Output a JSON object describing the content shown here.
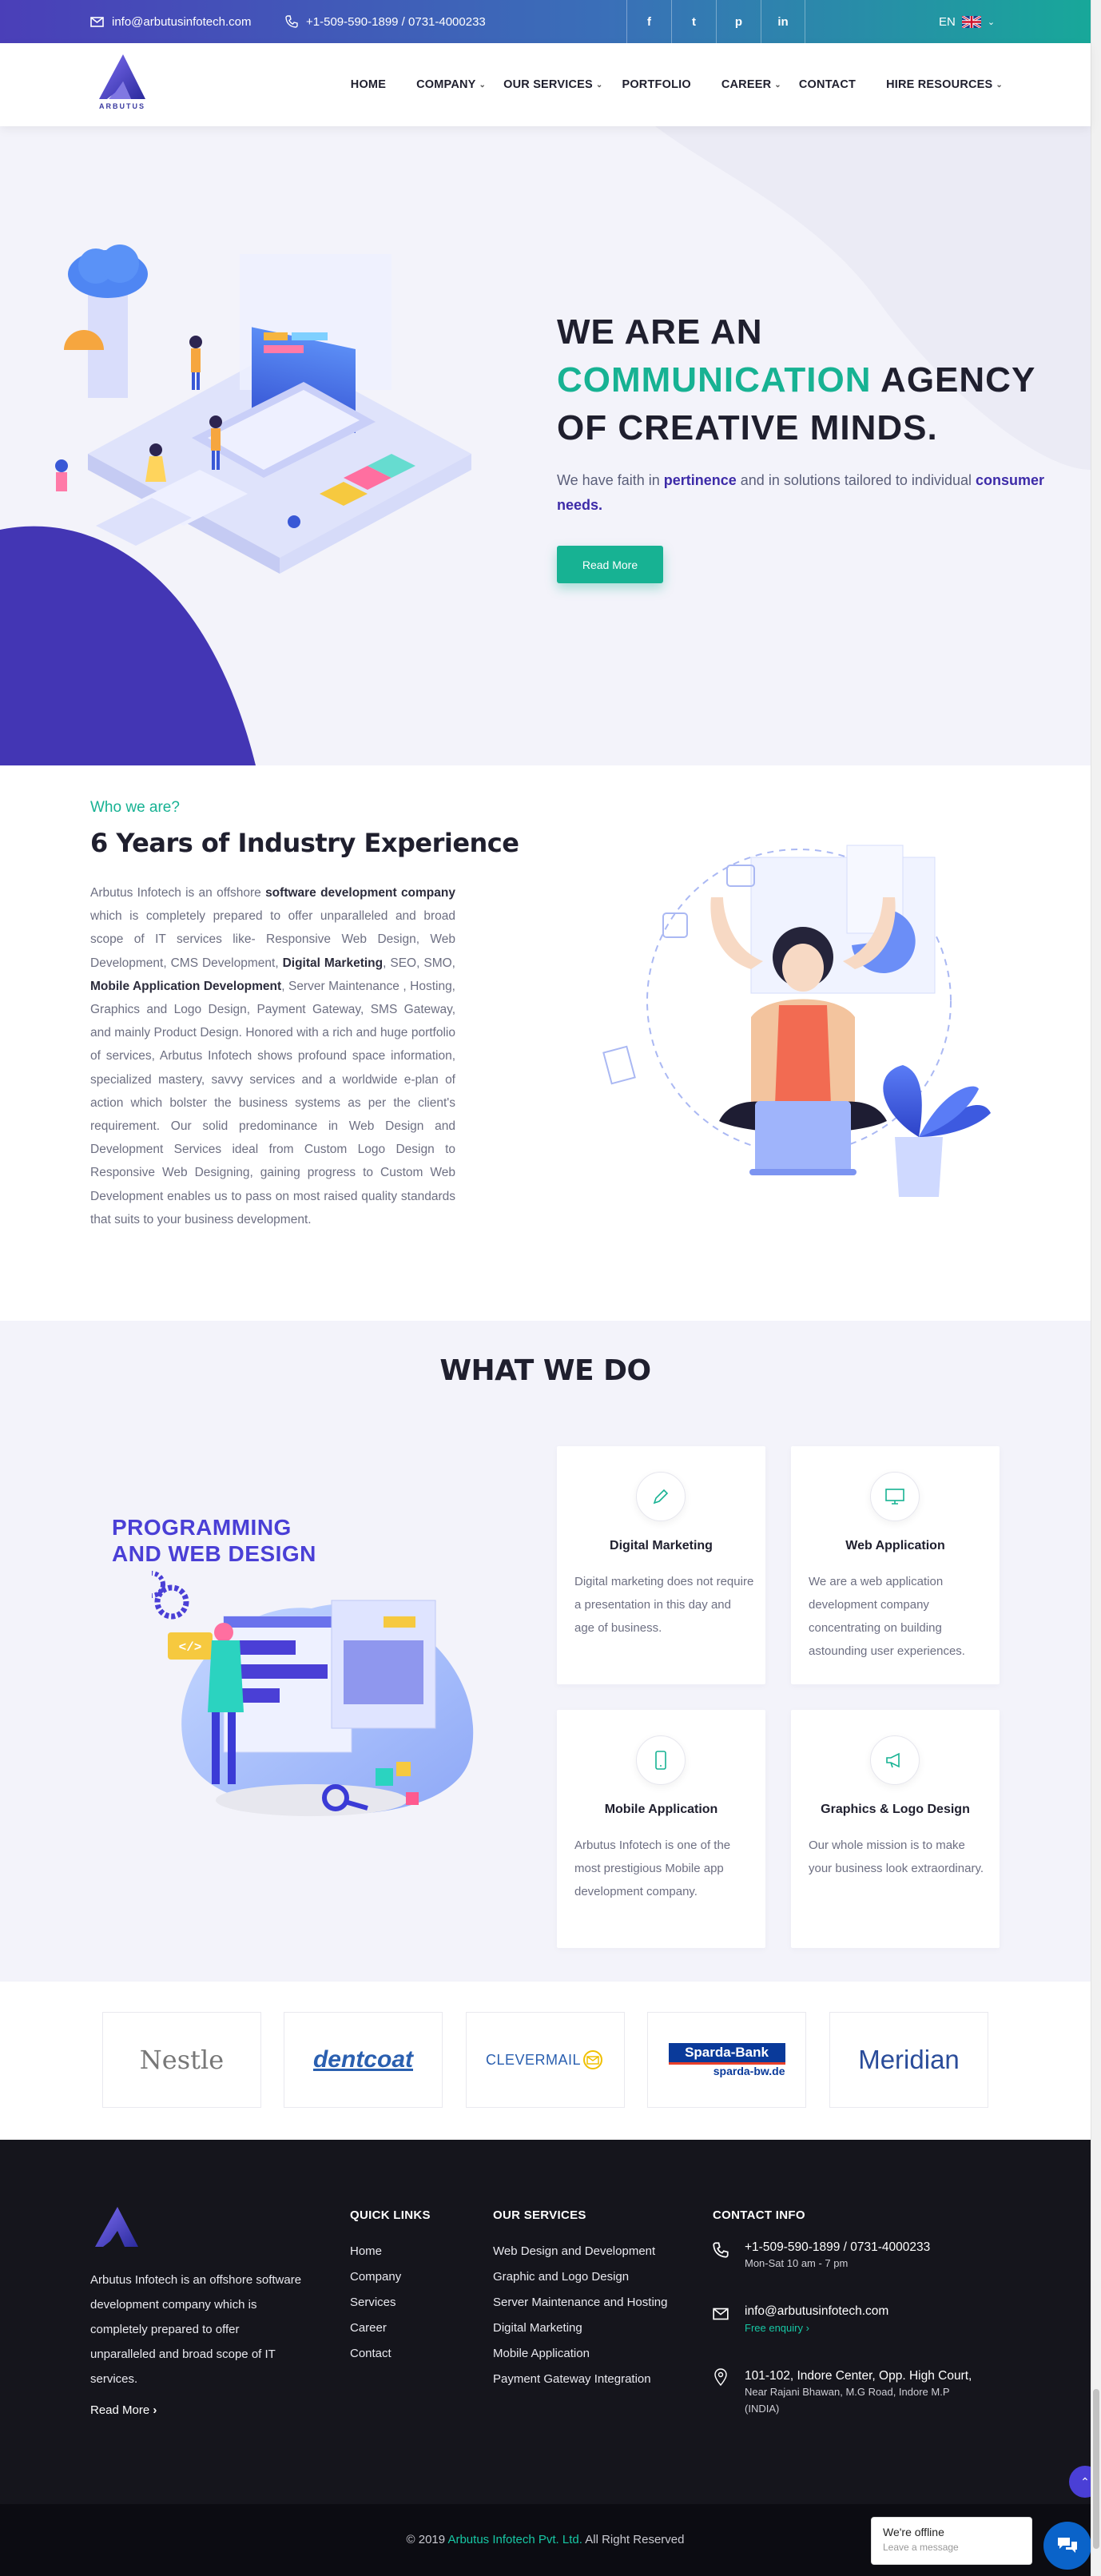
{
  "topbar": {
    "email": "info@arbutusinfotech.com",
    "phone": "+1-509-590-1899 / 0731-4000233",
    "social": [
      "f",
      "t",
      "p",
      "in"
    ],
    "lang": "EN"
  },
  "logo": {
    "text": "ARBUTUS"
  },
  "nav": {
    "items": [
      {
        "label": "HOME"
      },
      {
        "label": "COMPANY"
      },
      {
        "label": "OUR SERVICES"
      },
      {
        "label": "PORTFOLIO"
      },
      {
        "label": "CAREER"
      },
      {
        "label": "CONTACT"
      },
      {
        "label": "HIRE RESOURCES"
      }
    ]
  },
  "hero": {
    "line1": "WE ARE AN",
    "accent": "COMMUNICATION",
    "line2_rest": " AGENCY",
    "line3": "OF CREATIVE MINDS.",
    "p_pre": "We have faith in ",
    "p_b1": "pertinence",
    "p_mid": " and in solutions tailored to individual ",
    "p_b2": "consumer needs.",
    "button": "Read More"
  },
  "about": {
    "kicker": "Who we are?",
    "title": "6 Years of Industry Experience",
    "t1": "Arbutus Infotech is an offshore ",
    "b1": "software development company",
    "t2": " which is completely prepared to offer unparalleled and broad scope of IT services like- Responsive Web Design, Web Development, CMS Development, ",
    "b2": "Digital Marketing",
    "t3": ", SEO, SMO, ",
    "b3": "Mobile Application Development",
    "t4": ", Server Maintenance , Hosting, Graphics and Logo Design, Payment Gateway, SMS Gateway, and mainly Product Design. Honored with a rich and huge portfolio of services, Arbutus Infotech shows profound space information, specialized mastery, savvy services and a worldwide e-plan of action which bolster the business systems as per the client's requirement. Our solid predominance in Web Design and Development Services ideal from Custom Logo Design to Responsive Web Designing, gaining progress to Custom Web Development enables us to pass on most raised quality standards that suits to your business development."
  },
  "wwd": {
    "title": "WHAT WE DO",
    "feature_title1": "PROGRAMMING",
    "feature_title2": "AND WEB DESIGN",
    "cards": [
      {
        "title": "Digital Marketing",
        "text": "Digital marketing does not require a presentation in this day and age of business.",
        "icon": "pencil-icon"
      },
      {
        "title": "Web Application",
        "text": "We are a web application development company concentrating on building astounding user experiences.",
        "icon": "monitor-icon"
      },
      {
        "title": "Mobile Application",
        "text": "Arbutus Infotech is one of the most prestigious Mobile app development company.",
        "icon": "mobile-icon"
      },
      {
        "title": "Graphics & Logo Design",
        "text": "Our whole mission is to make your business look extraordinary.",
        "icon": "megaphone-icon"
      }
    ]
  },
  "clients": [
    "Nestle",
    "dentcoat",
    "CLEVERMAIL",
    "Sparda-Bank",
    "sparda-bw.de",
    "Meridian"
  ],
  "footer": {
    "about": "Arbutus Infotech is an offshore software development company which is completely prepared to offer unparalleled and broad scope of IT services.",
    "readmore": "Read More",
    "quick_title": "QUICK LINKS",
    "quick": [
      "Home",
      "Company",
      "Services",
      "Career",
      "Contact"
    ],
    "services_title": "OUR SERVICES",
    "services": [
      "Web Design and Development",
      "Graphic and Logo Design",
      "Server Maintenance and Hosting",
      "Digital Marketing",
      "Mobile Application",
      "Payment Gateway Integration"
    ],
    "contact_title": "CONTACT INFO",
    "phone": "+1-509-590-1899 / 0731-4000233",
    "hours": "Mon-Sat 10 am - 7 pm",
    "email": "info@arbutusinfotech.com",
    "enquiry": "Free enquiry",
    "address1": "101-102, Indore Center, Opp. High Court,",
    "address2": "Near Rajani Bhawan, M.G Road, Indore M.P",
    "address3": "(INDIA)"
  },
  "copyright": {
    "pre": "© 2019 ",
    "company": "Arbutus Infotech Pvt. Ltd.",
    "post": " All Right Reserved"
  },
  "chat": {
    "status": "We're offline",
    "action": "Leave a message"
  },
  "colors": {
    "accent": "#17b293",
    "brand": "#4a3fd6",
    "footer": "#15151c"
  }
}
